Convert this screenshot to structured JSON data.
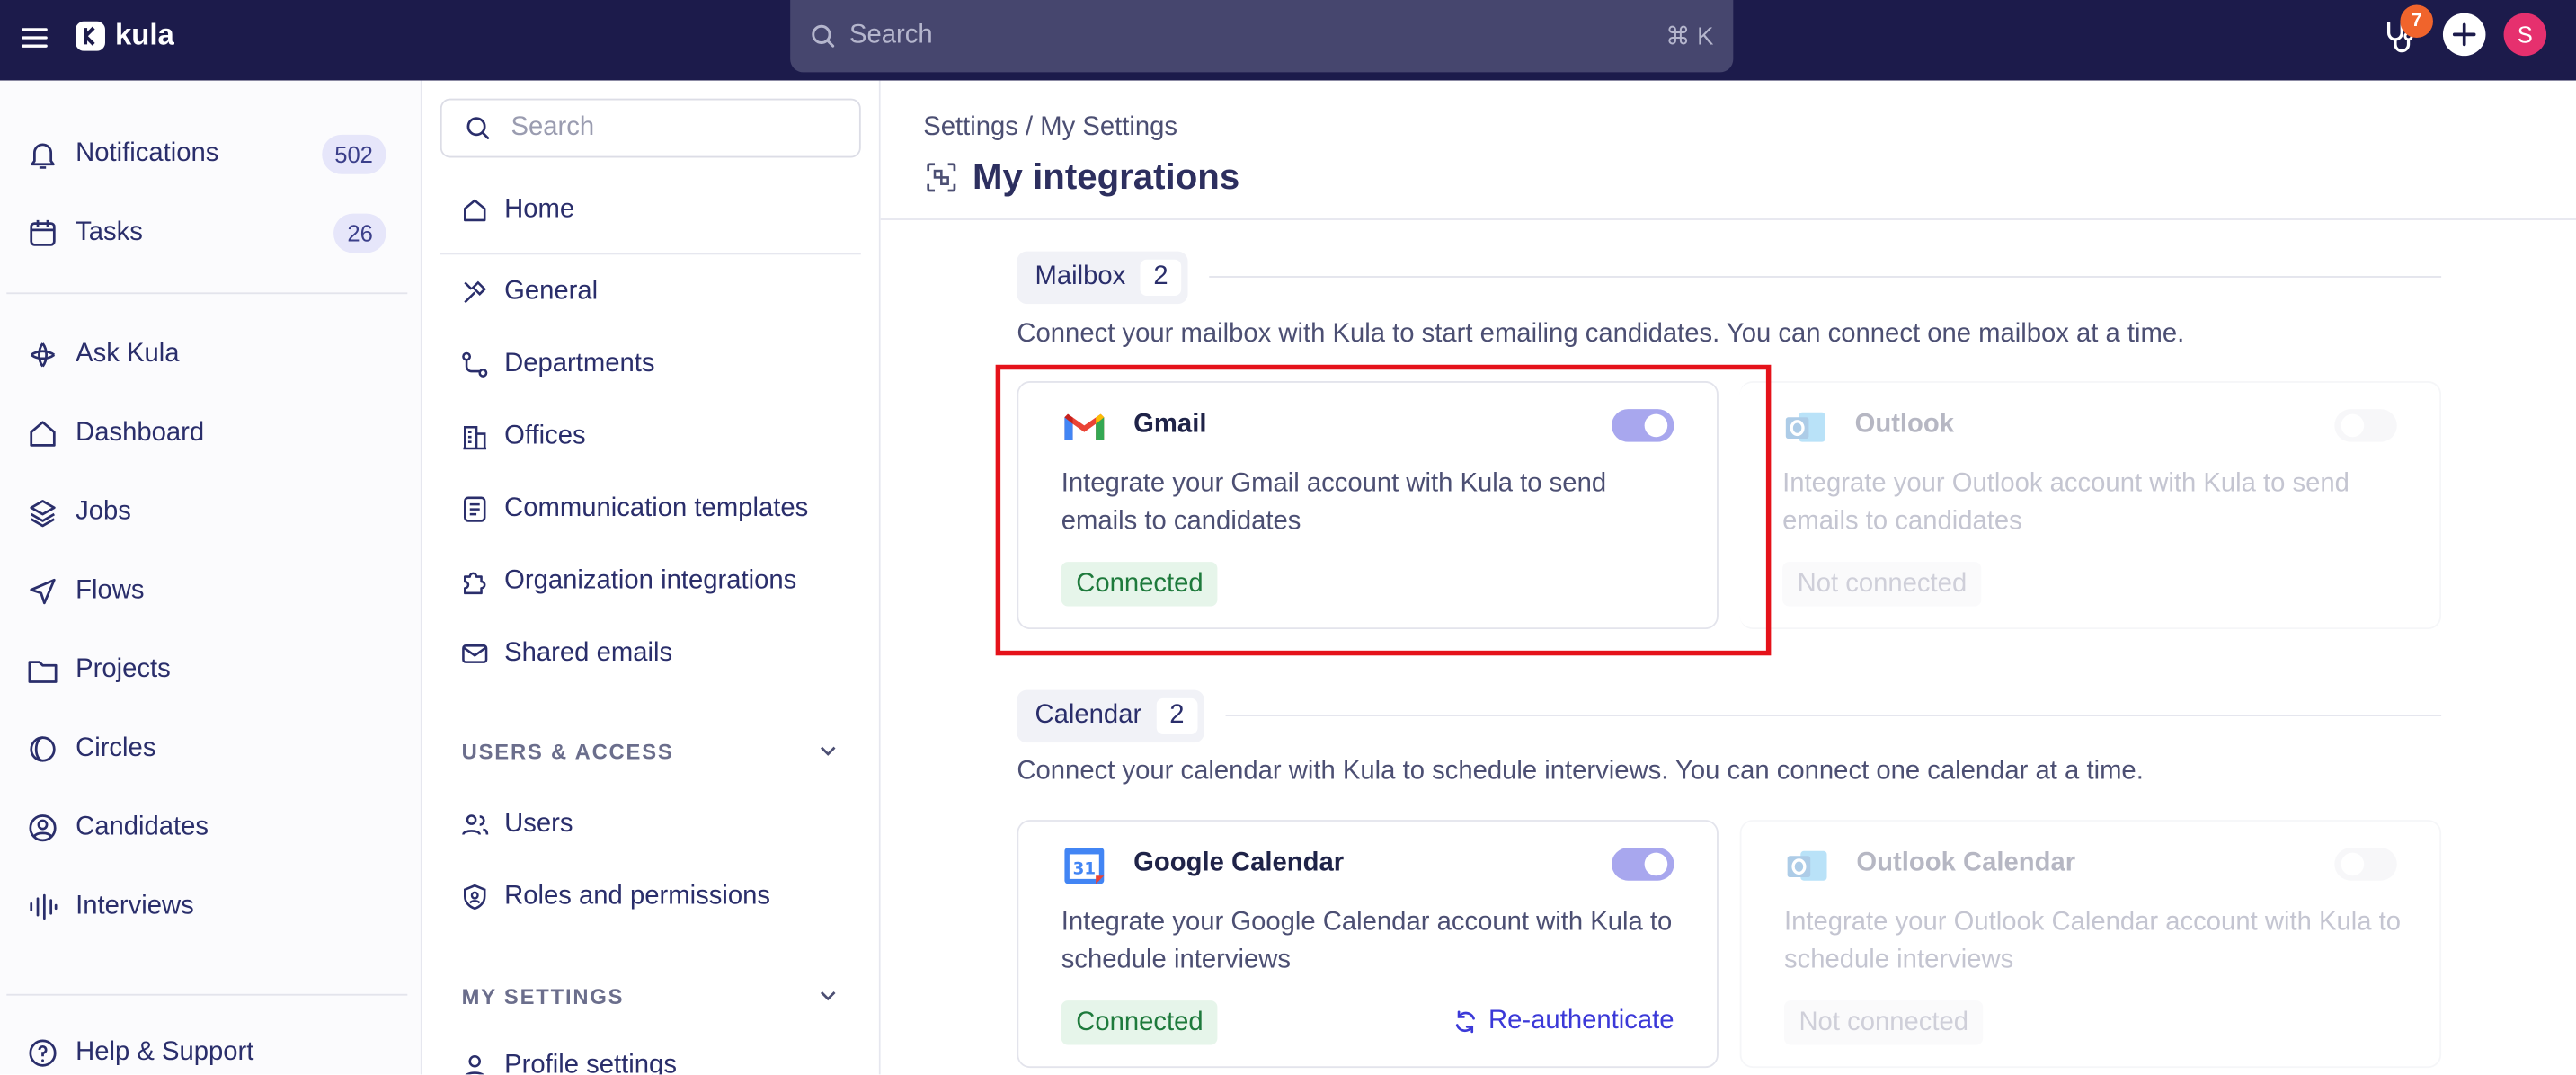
{
  "topbar": {
    "brand": "kula",
    "search_placeholder": "Search",
    "search_shortcut": "⌘ K",
    "notification_count": "7",
    "avatar_initial": "S",
    "icons": [
      "menu-icon",
      "kula-logo-icon",
      "search-icon",
      "stethoscope-icon",
      "plus-icon"
    ]
  },
  "leftnav": {
    "items": [
      {
        "label": "Notifications",
        "count": "502",
        "icon": "bell-icon"
      },
      {
        "label": "Tasks",
        "count": "26",
        "icon": "calendar-icon"
      },
      {
        "label": "Ask Kula",
        "icon": "kula-ai-icon"
      },
      {
        "label": "Dashboard",
        "icon": "home-icon"
      },
      {
        "label": "Jobs",
        "icon": "layers-icon"
      },
      {
        "label": "Flows",
        "icon": "send-icon"
      },
      {
        "label": "Projects",
        "icon": "folder-icon"
      },
      {
        "label": "Circles",
        "icon": "circle-half-icon"
      },
      {
        "label": "Candidates",
        "icon": "user-circle-icon"
      },
      {
        "label": "Interviews",
        "icon": "waveform-icon"
      },
      {
        "label": "Help & Support",
        "icon": "help-icon"
      }
    ]
  },
  "settings_nav": {
    "search_placeholder": "Search",
    "home_label": "Home",
    "items": [
      {
        "label": "General",
        "icon": "tools-icon"
      },
      {
        "label": "Departments",
        "icon": "route-icon"
      },
      {
        "label": "Offices",
        "icon": "building-icon"
      },
      {
        "label": "Communication templates",
        "icon": "document-icon"
      },
      {
        "label": "Organization integrations",
        "icon": "puzzle-icon"
      },
      {
        "label": "Shared emails",
        "icon": "mail-icon"
      }
    ],
    "users_section": "USERS & ACCESS",
    "users_items": [
      {
        "label": "Users",
        "icon": "users-icon"
      },
      {
        "label": "Roles and permissions",
        "icon": "shield-user-icon"
      }
    ],
    "my_settings_section": "MY SETTINGS",
    "my_settings_items": [
      {
        "label": "Profile settings",
        "icon": "user-icon"
      }
    ]
  },
  "main": {
    "breadcrumb": "Settings / My Settings",
    "title": "My integrations",
    "mailbox": {
      "label": "Mailbox",
      "count": "2",
      "description": "Connect your mailbox with Kula to start emailing candidates. You can connect one mailbox at a time.",
      "cards": [
        {
          "name": "Gmail",
          "description": "Integrate your Gmail account with Kula to send emails to candidates",
          "status": "Connected",
          "enabled": true
        },
        {
          "name": "Outlook",
          "description": "Integrate your Outlook account with Kula to send emails to candidates",
          "status": "Not connected",
          "enabled": false
        }
      ]
    },
    "calendar": {
      "label": "Calendar",
      "count": "2",
      "description": "Connect your calendar with Kula to schedule interviews. You can connect one calendar at a time.",
      "cards": [
        {
          "name": "Google Calendar",
          "description": "Integrate your Google Calendar account with Kula to schedule interviews",
          "status": "Connected",
          "enabled": true,
          "action": "Re-authenticate"
        },
        {
          "name": "Outlook Calendar",
          "description": "Integrate your Outlook Calendar account with Kula to schedule interviews",
          "status": "Not connected",
          "enabled": false
        }
      ]
    }
  },
  "colors": {
    "topbar": "#1c1b4b",
    "accent": "#3b39d8",
    "connected_bg": "#e6f5ea",
    "connected_text": "#1e7a3c",
    "highlight": "#e5121a"
  }
}
